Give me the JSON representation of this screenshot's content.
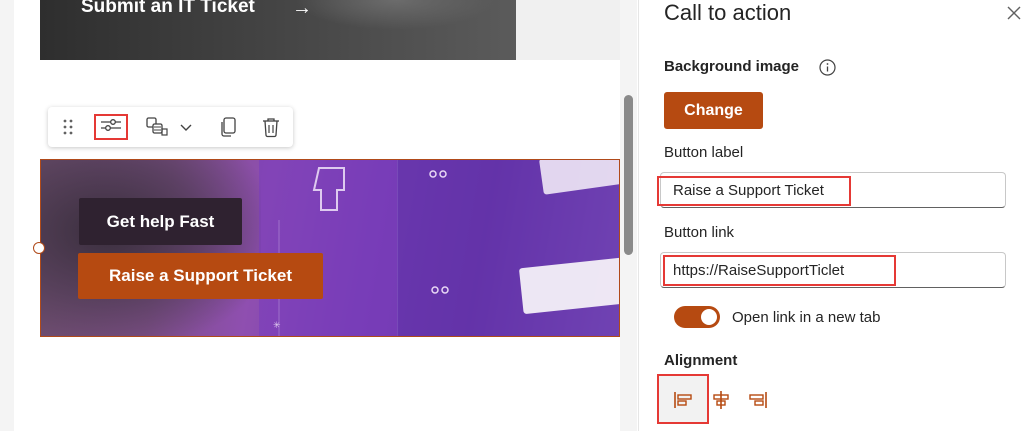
{
  "canvas": {
    "hero_link_text": "Submit an IT Ticket",
    "hero_link_arrow": "→",
    "toolbar": {
      "icons": [
        "drag-handle-icon",
        "edit-settings-icon",
        "swap-layout-icon",
        "chevron-down-icon",
        "duplicate-icon",
        "delete-icon"
      ]
    },
    "cta": {
      "primary_button": "Get help Fast",
      "secondary_button": "Raise a Support Ticket"
    }
  },
  "pane": {
    "title": "Call to action",
    "background_image_label": "Background image",
    "change_button": "Change",
    "button_label_label": "Button label",
    "button_label_value": "Raise a Support Ticket",
    "button_link_label": "Button link",
    "button_link_value": "https://RaiseSupportTiclet",
    "open_new_tab_label": "Open link in a new tab",
    "open_new_tab_on": true,
    "alignment_label": "Alignment",
    "alignment_options": [
      "align-left-icon",
      "align-center-icon",
      "align-right-icon"
    ],
    "alignment_selected": "left"
  },
  "colors": {
    "accent": "#b64a11",
    "highlight": "#e53935"
  }
}
